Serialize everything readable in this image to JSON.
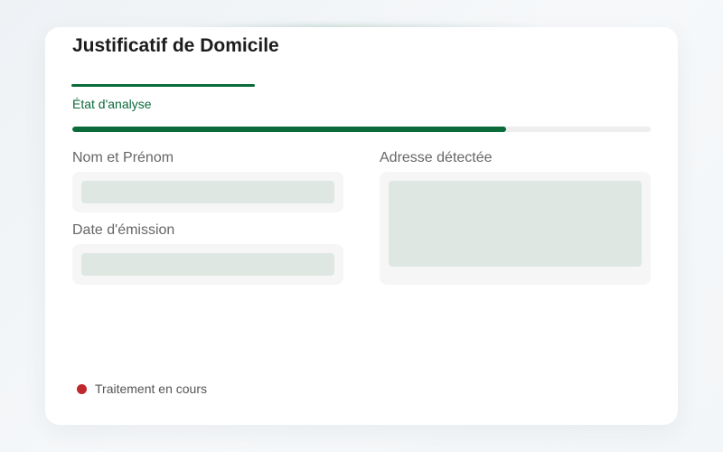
{
  "document": {
    "title": "Justificatif de Domicile"
  },
  "analysis": {
    "label": "État d'analyse",
    "progress_fraction": 0.75,
    "accent_color": "#0b6b3a"
  },
  "fields": {
    "name": {
      "label": "Nom et Prénom",
      "value": ""
    },
    "issue_date": {
      "label": "Date d'émission",
      "value": ""
    },
    "address": {
      "label": "Adresse détectée",
      "value": ""
    }
  },
  "status": {
    "text": "Traitement en cours",
    "dot_color": "#c0282e"
  }
}
